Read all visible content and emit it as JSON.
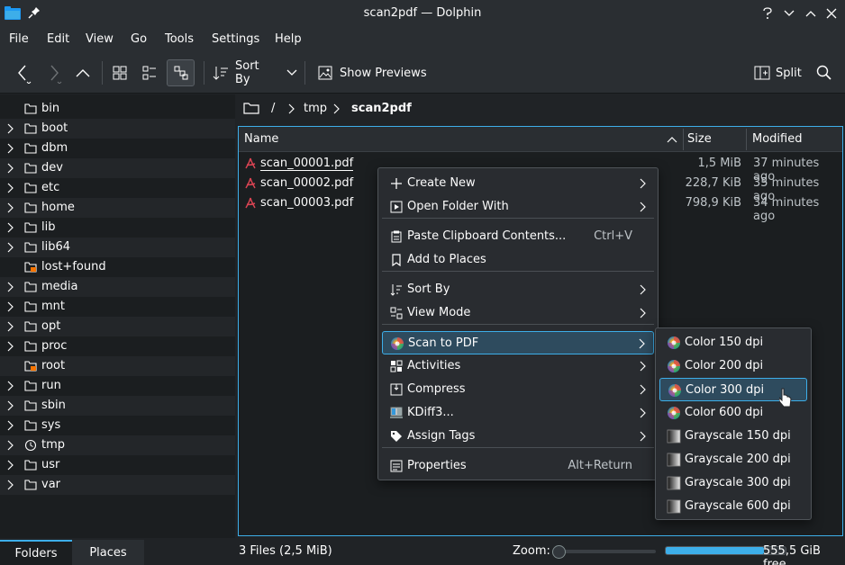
{
  "window": {
    "title": "scan2pdf — Dolphin"
  },
  "menubar": [
    "File",
    "Edit",
    "View",
    "Go",
    "Tools",
    "Settings",
    "Help"
  ],
  "toolbar": {
    "sort_by": "Sort By",
    "show_previews": "Show Previews",
    "split": "Split"
  },
  "sidebar": {
    "items": [
      "bin",
      "boot",
      "dbm",
      "dev",
      "etc",
      "home",
      "lib",
      "lib64",
      "lost+found",
      "media",
      "mnt",
      "opt",
      "proc",
      "root",
      "run",
      "sbin",
      "sys",
      "tmp",
      "usr",
      "var"
    ],
    "tabs": [
      "Folders",
      "Places"
    ]
  },
  "breadcrumb": {
    "root": "/",
    "parts": [
      "tmp",
      "scan2pdf"
    ]
  },
  "columns": {
    "name": "Name",
    "size": "Size",
    "modified": "Modified"
  },
  "files": [
    {
      "name": "scan_00001.pdf",
      "size": "1,5 MiB",
      "modified": "37 minutes ago"
    },
    {
      "name": "scan_00002.pdf",
      "size": "228,7 KiB",
      "modified": "35 minutes ago"
    },
    {
      "name": "scan_00003.pdf",
      "size": "798,9 KiB",
      "modified": "34 minutes ago"
    }
  ],
  "context_menu": [
    {
      "label": "Create New",
      "submenu": true
    },
    {
      "label": "Open Folder With",
      "submenu": true
    },
    {
      "label": "Paste Clipboard Contents...",
      "shortcut": "Ctrl+V"
    },
    {
      "label": "Add to Places"
    },
    {
      "label": "Sort By",
      "submenu": true
    },
    {
      "label": "View Mode",
      "submenu": true
    },
    {
      "label": "Scan to PDF",
      "submenu": true
    },
    {
      "label": "Activities",
      "submenu": true
    },
    {
      "label": "Compress",
      "submenu": true
    },
    {
      "label": "KDiff3...",
      "submenu": true
    },
    {
      "label": "Assign Tags",
      "submenu": true
    },
    {
      "label": "Properties",
      "shortcut": "Alt+Return"
    }
  ],
  "scan_submenu": [
    "Color 150 dpi",
    "Color 200 dpi",
    "Color 300 dpi",
    "Color 600 dpi",
    "Grayscale 150 dpi",
    "Grayscale 200 dpi",
    "Grayscale 300 dpi",
    "Grayscale 600 dpi"
  ],
  "status": {
    "files": "3 Files (2,5 MiB)",
    "zoom_label": "Zoom:",
    "free": "555,5 GiB free",
    "zoom_level": 0,
    "disk_used_fraction": 0.82
  },
  "colors": {
    "accent": "#3daee9",
    "pdf_icon": "#da4453"
  }
}
